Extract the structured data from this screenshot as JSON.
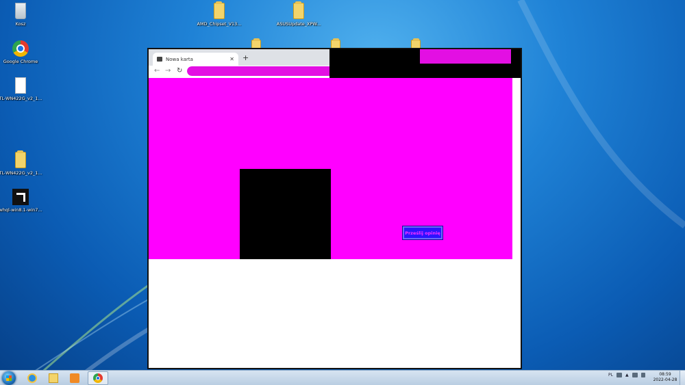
{
  "desktop": {
    "icons": [
      {
        "label": "Kosz",
        "icon": "recycle-bin-icon"
      },
      {
        "label": "Google Chrome",
        "icon": "chrome-icon"
      },
      {
        "label": "TL-WN422G_v2_1...",
        "icon": "file-icon"
      },
      {
        "label": "TL-WN422G_v2_1...",
        "icon": "folder-icon"
      },
      {
        "label": "whql-win8.1-win7...",
        "icon": "amd-icon"
      },
      {
        "label": "AMD_Chipset_V13...",
        "icon": "folder-icon"
      },
      {
        "label": "ASUSUpdate_XPW...",
        "icon": "folder-icon"
      }
    ]
  },
  "browser": {
    "tab_title": "Nowa karta",
    "tab_close": "✕",
    "new_tab": "+",
    "nav": {
      "back": "←",
      "forward": "→",
      "reload": "↻"
    },
    "omnibox_icons": {
      "share": "⇪",
      "bookmark": "☆"
    },
    "content": {
      "button_label": "Prześlij opinię",
      "colors": {
        "background": "#ff00ff",
        "block": "#000000",
        "button": "#2c14ff"
      }
    }
  },
  "taskbar": {
    "apps": [
      {
        "name": "internet-explorer",
        "icon": "ie-icon"
      },
      {
        "name": "file-explorer",
        "icon": "explorer-icon"
      },
      {
        "name": "media-player",
        "icon": "media-player-icon"
      },
      {
        "name": "google-chrome",
        "icon": "chrome-icon",
        "active": true
      }
    ],
    "language": "PL",
    "time": "08:59",
    "date": "2022-04-28"
  }
}
